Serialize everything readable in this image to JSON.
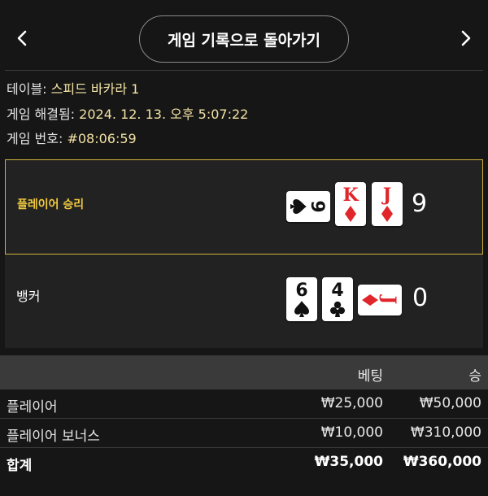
{
  "header": {
    "back_label": "게임 기록으로 돌아가기",
    "prev_icon": "chevron-left-icon",
    "next_icon": "chevron-right-icon"
  },
  "info": {
    "table_key": "테이블:",
    "table_value": "스피드 바카라 1",
    "resolved_key": "게임 해결됨:",
    "resolved_value": "2024. 12. 13. 오후 5:07:22",
    "number_key": "게임 번호:",
    "number_value": "#08:06:59"
  },
  "player": {
    "label": "플레이어 승리",
    "score": "9",
    "cards": [
      {
        "rank": "9",
        "suit": "spade",
        "rotated": true
      },
      {
        "rank": "K",
        "suit": "diamond",
        "rotated": false
      },
      {
        "rank": "J",
        "suit": "diamond",
        "rotated": false
      }
    ]
  },
  "banker": {
    "label": "뱅커",
    "score": "0",
    "cards": [
      {
        "rank": "6",
        "suit": "spade",
        "rotated": false
      },
      {
        "rank": "4",
        "suit": "club",
        "rotated": false
      },
      {
        "rank": "J",
        "suit": "diamond",
        "rotated": true
      }
    ]
  },
  "bets": {
    "header_bet": "베팅",
    "header_win": "승",
    "rows": [
      {
        "label": "플레이어",
        "bet": "₩25,000",
        "win": "₩50,000"
      },
      {
        "label": "플레이어 보너스",
        "bet": "₩10,000",
        "win": "₩310,000"
      }
    ],
    "total": {
      "label": "합계",
      "bet": "₩35,000",
      "win": "₩360,000"
    }
  },
  "colors": {
    "winner_border": "#d0b33a",
    "winner_label": "#f0c93f",
    "info_value": "#f2e2a4",
    "red_suit": "#e0262b",
    "black_suit": "#111111"
  }
}
